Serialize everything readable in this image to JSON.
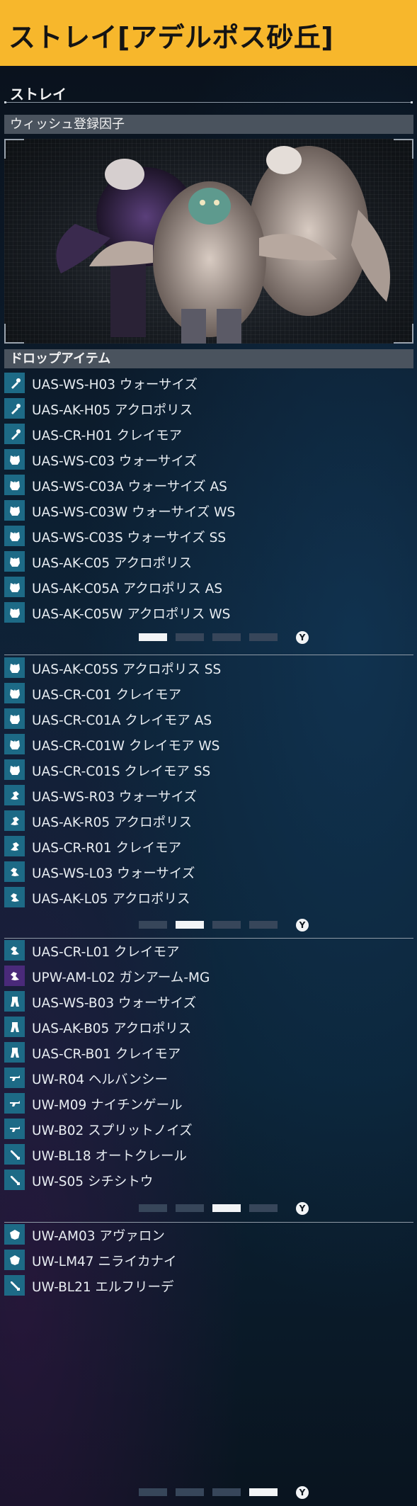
{
  "header": {
    "title": "ストレイ[アデルポス砂丘]"
  },
  "section": {
    "title": "ストレイ"
  },
  "wish_bar": {
    "label": "ウィッシュ登録因子"
  },
  "drop_bar": {
    "label": "ドロップアイテム"
  },
  "pager_button": "Y",
  "pages": [
    {
      "active": 0,
      "items": [
        {
          "icon": "arm-part-icon",
          "label": "UAS-WS-H03 ウォーサイズ"
        },
        {
          "icon": "arm-part-icon",
          "label": "UAS-AK-H05 アクロポリス"
        },
        {
          "icon": "arm-part-icon",
          "label": "UAS-CR-H01 クレイモア"
        },
        {
          "icon": "chest-armor-icon",
          "label": "UAS-WS-C03 ウォーサイズ"
        },
        {
          "icon": "chest-armor-icon",
          "label": "UAS-WS-C03A ウォーサイズ AS"
        },
        {
          "icon": "chest-armor-icon",
          "label": "UAS-WS-C03W ウォーサイズ WS"
        },
        {
          "icon": "chest-armor-icon",
          "label": "UAS-WS-C03S ウォーサイズ SS"
        },
        {
          "icon": "chest-armor-icon",
          "label": "UAS-AK-C05 アクロポリス"
        },
        {
          "icon": "chest-armor-icon",
          "label": "UAS-AK-C05A アクロポリス AS"
        },
        {
          "icon": "chest-armor-icon",
          "label": "UAS-AK-C05W アクロポリス WS"
        }
      ]
    },
    {
      "active": 1,
      "items": [
        {
          "icon": "chest-armor-icon",
          "label": "UAS-AK-C05S アクロポリス SS"
        },
        {
          "icon": "chest-armor-icon",
          "label": "UAS-CR-C01 クレイモア"
        },
        {
          "icon": "chest-armor-icon",
          "label": "UAS-CR-C01A クレイモア AS"
        },
        {
          "icon": "chest-armor-icon",
          "label": "UAS-CR-C01W クレイモア WS"
        },
        {
          "icon": "chest-armor-icon",
          "label": "UAS-CR-C01S クレイモア SS"
        },
        {
          "icon": "right-arm-icon",
          "label": "UAS-WS-R03 ウォーサイズ"
        },
        {
          "icon": "right-arm-icon",
          "label": "UAS-AK-R05 アクロポリス"
        },
        {
          "icon": "right-arm-icon",
          "label": "UAS-CR-R01 クレイモア"
        },
        {
          "icon": "left-arm-icon",
          "label": "UAS-WS-L03 ウォーサイズ"
        },
        {
          "icon": "left-arm-icon",
          "label": "UAS-AK-L05 アクロポリス"
        }
      ]
    },
    {
      "active": 2,
      "items": [
        {
          "icon": "left-arm-icon",
          "label": "UAS-CR-L01 クレイモア"
        },
        {
          "icon": "left-arm-icon",
          "label": "UPW-AM-L02 ガンアーム-MG",
          "accent": "purple"
        },
        {
          "icon": "leg-armor-icon",
          "label": "UAS-WS-B03 ウォーサイズ"
        },
        {
          "icon": "leg-armor-icon",
          "label": "UAS-AK-B05 アクロポリス"
        },
        {
          "icon": "leg-armor-icon",
          "label": "UAS-CR-B01 クレイモア"
        },
        {
          "icon": "gun-icon",
          "label": "UW-R04 ヘルバンシー"
        },
        {
          "icon": "gun-icon",
          "label": "UW-M09 ナイチンゲール"
        },
        {
          "icon": "gun-icon",
          "label": "UW-B02 スプリットノイズ"
        },
        {
          "icon": "blade-icon",
          "label": "UW-BL18 オートクレール"
        },
        {
          "icon": "blade-icon",
          "label": "UW-S05 シチシトウ"
        }
      ]
    },
    {
      "active": 3,
      "items": [
        {
          "icon": "shield-icon",
          "label": "UW-AM03 アヴァロン"
        },
        {
          "icon": "shield-icon",
          "label": "UW-LM47 ニライカナイ"
        },
        {
          "icon": "blade-icon",
          "label": "UW-BL21 エルフリーデ"
        }
      ]
    }
  ],
  "colors": {
    "header": "#f7b72c",
    "icon_bg": "#1d6a86",
    "icon_bg_purple": "#4a2a7a"
  }
}
